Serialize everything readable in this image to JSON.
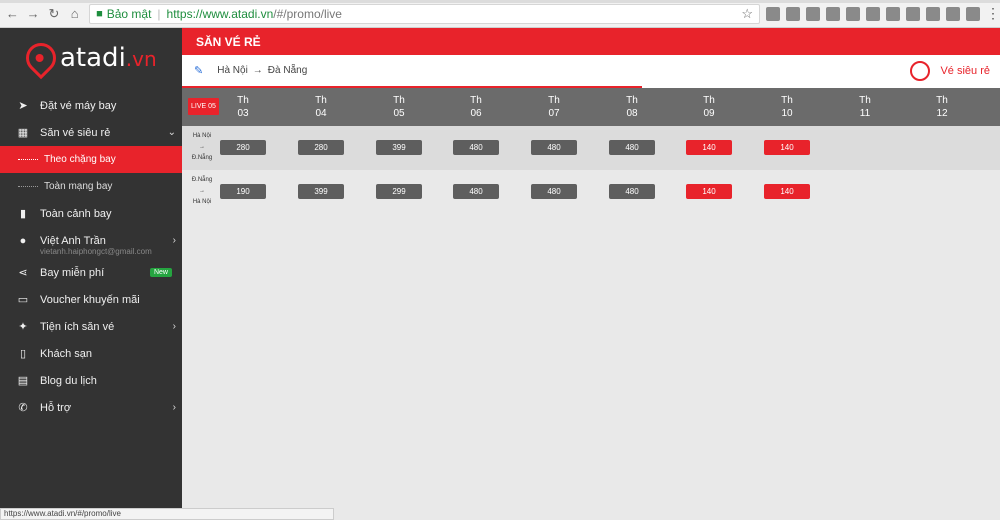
{
  "browser": {
    "secure_label": "Bảo mật",
    "url_host": "https://www.atadi.vn",
    "url_path": "/#/promo/live",
    "status_url": "https://www.atadi.vn/#/promo/live"
  },
  "logo": {
    "text": "atadi",
    "suffix": ".vn"
  },
  "sidebar": {
    "items": [
      {
        "label": "Đặt vé máy bay",
        "icon": "paper-plane-icon"
      },
      {
        "label": "Săn vé siêu rẻ",
        "icon": "calendar-icon"
      },
      {
        "label": "Toàn cảnh bay",
        "icon": "bar-chart-icon"
      },
      {
        "label": "Việt Anh Trần",
        "icon": "user-icon"
      },
      {
        "label": "Bay miễn phí",
        "icon": "share-icon"
      },
      {
        "label": "Voucher khuyến mãi",
        "icon": "card-icon"
      },
      {
        "label": "Tiện ích săn vé",
        "icon": "magic-wand-icon"
      },
      {
        "label": "Khách sạn",
        "icon": "building-icon"
      },
      {
        "label": "Blog du lịch",
        "icon": "book-icon"
      },
      {
        "label": "Hỗ trợ",
        "icon": "phone-icon"
      }
    ],
    "sub_items": [
      {
        "label": "Theo chặng bay"
      },
      {
        "label": "Toàn mạng bay"
      }
    ],
    "user_email": "vietanh.haiphongct@gmail.com",
    "new_badge": "New"
  },
  "header": {
    "title": "SĂN VÉ RẺ"
  },
  "route": {
    "from": "Hà Nội",
    "to": "Đà Nẵng",
    "cheap_label": "Vé siêu rẻ"
  },
  "live_badge": "LIVE 05",
  "days": [
    {
      "top": "Th",
      "num": "03"
    },
    {
      "top": "Th",
      "num": "04"
    },
    {
      "top": "Th",
      "num": "05"
    },
    {
      "top": "Th",
      "num": "06"
    },
    {
      "top": "Th",
      "num": "07"
    },
    {
      "top": "Th",
      "num": "08"
    },
    {
      "top": "Th",
      "num": "09"
    },
    {
      "top": "Th",
      "num": "10"
    },
    {
      "top": "Th",
      "num": "11"
    },
    {
      "top": "Th",
      "num": "12"
    }
  ],
  "rows": [
    {
      "from": "Hà Nội",
      "arrow": "→",
      "to": "Đ.Nẵng",
      "prices": [
        "280",
        "280",
        "399",
        "480",
        "480",
        "480",
        "140",
        "140"
      ]
    },
    {
      "from": "Đ.Nẵng",
      "arrow": "→",
      "to": "Hà Nội",
      "prices": [
        "190",
        "399",
        "299",
        "480",
        "480",
        "480",
        "140",
        "140"
      ]
    }
  ],
  "colors": {
    "accent": "#e8232b",
    "sidebar": "#333333",
    "price": "#5e5e5e"
  }
}
